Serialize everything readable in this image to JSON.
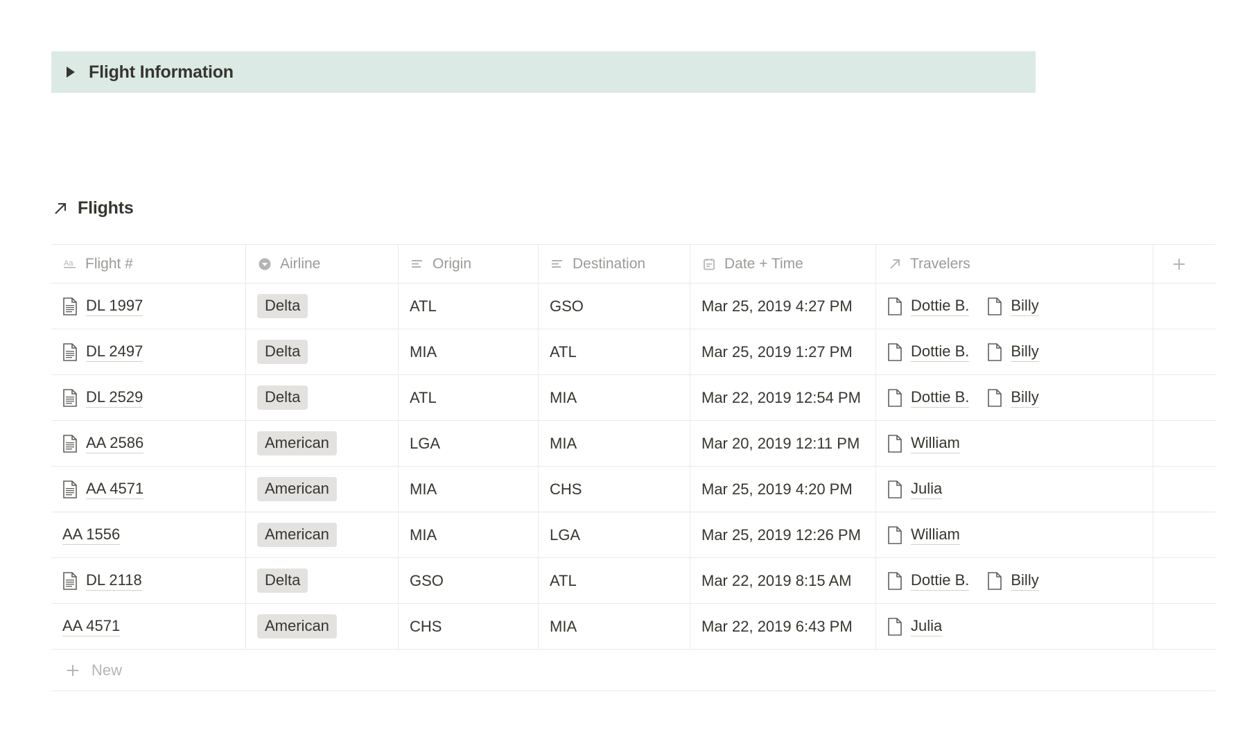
{
  "toggle": {
    "arrow_icon": "triangle-right-icon",
    "title": "Flight Information"
  },
  "database": {
    "icon": "arrow-up-right-icon",
    "title": "Flights",
    "add_column_label": "+",
    "new_row_label": "New",
    "columns": [
      {
        "label": "Flight #",
        "icon": "text-aa-icon"
      },
      {
        "label": "Airline",
        "icon": "select-chevron-icon"
      },
      {
        "label": "Origin",
        "icon": "multiline-text-icon"
      },
      {
        "label": "Destination",
        "icon": "multiline-text-icon"
      },
      {
        "label": "Date + Time",
        "icon": "calendar-icon"
      },
      {
        "label": "Travelers",
        "icon": "relation-arrow-icon"
      }
    ],
    "rows": [
      {
        "flight": "DL 1997",
        "has_page_icon": true,
        "airline": "Delta",
        "origin": "ATL",
        "destination": "GSO",
        "datetime": "Mar 25, 2019 4:27 PM",
        "travelers": [
          "Dottie B.",
          "Billy"
        ]
      },
      {
        "flight": "DL 2497",
        "has_page_icon": true,
        "airline": "Delta",
        "origin": "MIA",
        "destination": "ATL",
        "datetime": "Mar 25, 2019 1:27 PM",
        "travelers": [
          "Dottie B.",
          "Billy"
        ]
      },
      {
        "flight": "DL 2529",
        "has_page_icon": true,
        "airline": "Delta",
        "origin": "ATL",
        "destination": "MIA",
        "datetime": "Mar 22, 2019 12:54 PM",
        "travelers": [
          "Dottie B.",
          "Billy"
        ]
      },
      {
        "flight": "AA 2586",
        "has_page_icon": true,
        "airline": "American",
        "origin": "LGA",
        "destination": "MIA",
        "datetime": "Mar 20, 2019 12:11 PM",
        "travelers": [
          "William"
        ]
      },
      {
        "flight": "AA 4571",
        "has_page_icon": true,
        "airline": "American",
        "origin": "MIA",
        "destination": "CHS",
        "datetime": "Mar 25, 2019 4:20 PM",
        "travelers": [
          "Julia"
        ]
      },
      {
        "flight": "AA 1556",
        "has_page_icon": false,
        "airline": "American",
        "origin": "MIA",
        "destination": "LGA",
        "datetime": "Mar 25, 2019 12:26 PM",
        "travelers": [
          "William"
        ]
      },
      {
        "flight": "DL 2118",
        "has_page_icon": true,
        "airline": "Delta",
        "origin": "GSO",
        "destination": "ATL",
        "datetime": "Mar 22, 2019 8:15 AM",
        "travelers": [
          "Dottie B.",
          "Billy"
        ]
      },
      {
        "flight": "AA 4571",
        "has_page_icon": false,
        "airline": "American",
        "origin": "CHS",
        "destination": "MIA",
        "datetime": "Mar 22, 2019 6:43 PM",
        "travelers": [
          "Julia"
        ]
      }
    ]
  },
  "colors": {
    "callout_background": "#dceae6",
    "tag_background": "#e3e2e0",
    "text_primary": "#37352f",
    "text_muted": "#9b9a97",
    "border": "#e9e9e7"
  }
}
